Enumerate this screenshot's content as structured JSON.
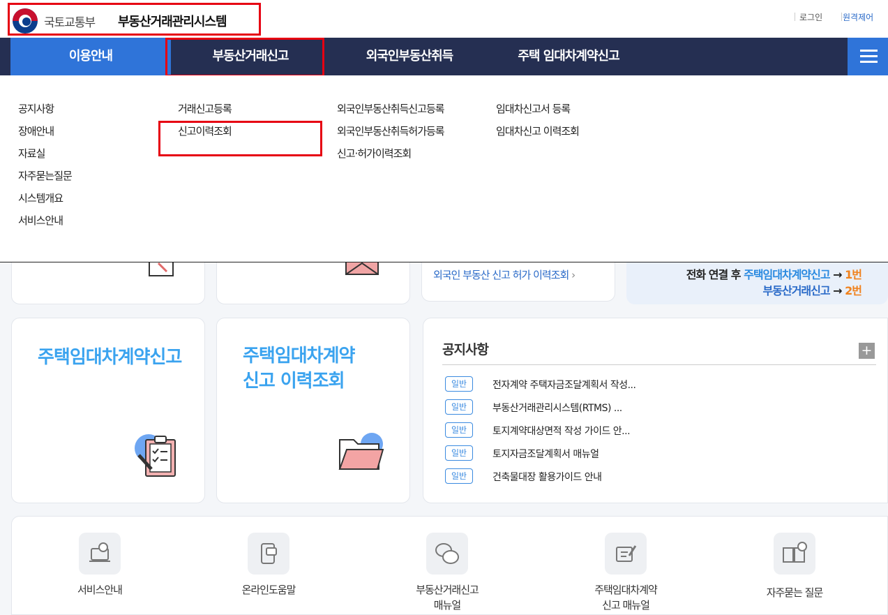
{
  "header": {
    "ministry": "국토교통부",
    "system_name": "부동산거래관리시스템",
    "login": "로그인",
    "remote": "원격제어"
  },
  "gnb": {
    "items": [
      {
        "label": "이용안내"
      },
      {
        "label": "부동산거래신고"
      },
      {
        "label": "외국인부동산취득"
      },
      {
        "label": "주택 임대차계약신고"
      }
    ]
  },
  "submenu": {
    "col1": [
      "공지사항",
      "장애안내",
      "자료실",
      "자주묻는질문",
      "시스템개요",
      "서비스안내"
    ],
    "col2": [
      "거래신고등록",
      "신고이력조회"
    ],
    "col3": [
      "외국인부동산취득신고등록",
      "외국인부동산취득허가등록",
      "신고·허가이력조회"
    ],
    "col4": [
      "임대차신고서 등록",
      "임대차신고 이력조회"
    ]
  },
  "partial": {
    "foreign_link": "외국인 부동산 신고 허가 이력조회",
    "call_prefix": "전화 연결 후",
    "call_1_label": "주택임대차계약신고",
    "call_1_num": "1번",
    "call_2_label": "부동산거래신고",
    "call_2_num": "2번",
    "arrow": "→"
  },
  "cards": {
    "rent_report": "주택임대차계약신고",
    "rent_history_1": "주택임대차계약",
    "rent_history_2": "신고 이력조회"
  },
  "notice": {
    "title": "공지사항",
    "more": "+",
    "items": [
      {
        "badge": "일반",
        "text": "전자계약 주택자금조달계획서 작성..."
      },
      {
        "badge": "일반",
        "text": "부동산거래관리시스템(RTMS) ..."
      },
      {
        "badge": "일반",
        "text": "토지계약대상면적 작성 가이드 안..."
      },
      {
        "badge": "일반",
        "text": "토지자금조달계획서 매뉴얼"
      },
      {
        "badge": "일반",
        "text": "건축물대장 활용가이드 안내"
      }
    ]
  },
  "quick": {
    "items": [
      {
        "label_1": "서비스안내",
        "label_2": ""
      },
      {
        "label_1": "온라인도움말",
        "label_2": ""
      },
      {
        "label_1": "부동산거래신고",
        "label_2": "매뉴얼"
      },
      {
        "label_1": "주택임대차계약",
        "label_2": "신고 매뉴얼"
      },
      {
        "label_1": "자주묻는 질문",
        "label_2": ""
      }
    ]
  }
}
